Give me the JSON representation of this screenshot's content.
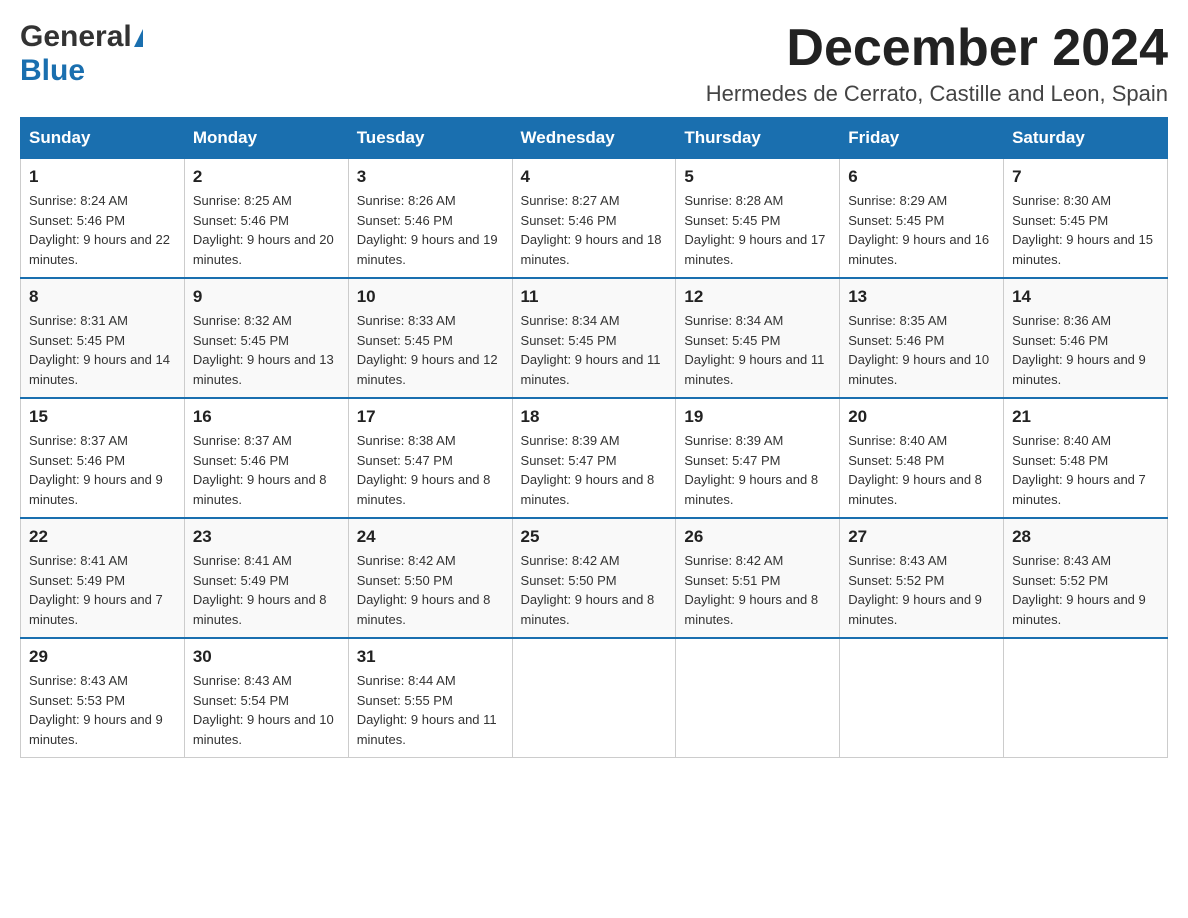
{
  "logo": {
    "general": "General",
    "blue": "Blue",
    "triangle": "▶"
  },
  "title": "December 2024",
  "location": "Hermedes de Cerrato, Castille and Leon, Spain",
  "days_of_week": [
    "Sunday",
    "Monday",
    "Tuesday",
    "Wednesday",
    "Thursday",
    "Friday",
    "Saturday"
  ],
  "weeks": [
    [
      {
        "day": "1",
        "sunrise": "Sunrise: 8:24 AM",
        "sunset": "Sunset: 5:46 PM",
        "daylight": "Daylight: 9 hours and 22 minutes."
      },
      {
        "day": "2",
        "sunrise": "Sunrise: 8:25 AM",
        "sunset": "Sunset: 5:46 PM",
        "daylight": "Daylight: 9 hours and 20 minutes."
      },
      {
        "day": "3",
        "sunrise": "Sunrise: 8:26 AM",
        "sunset": "Sunset: 5:46 PM",
        "daylight": "Daylight: 9 hours and 19 minutes."
      },
      {
        "day": "4",
        "sunrise": "Sunrise: 8:27 AM",
        "sunset": "Sunset: 5:46 PM",
        "daylight": "Daylight: 9 hours and 18 minutes."
      },
      {
        "day": "5",
        "sunrise": "Sunrise: 8:28 AM",
        "sunset": "Sunset: 5:45 PM",
        "daylight": "Daylight: 9 hours and 17 minutes."
      },
      {
        "day": "6",
        "sunrise": "Sunrise: 8:29 AM",
        "sunset": "Sunset: 5:45 PM",
        "daylight": "Daylight: 9 hours and 16 minutes."
      },
      {
        "day": "7",
        "sunrise": "Sunrise: 8:30 AM",
        "sunset": "Sunset: 5:45 PM",
        "daylight": "Daylight: 9 hours and 15 minutes."
      }
    ],
    [
      {
        "day": "8",
        "sunrise": "Sunrise: 8:31 AM",
        "sunset": "Sunset: 5:45 PM",
        "daylight": "Daylight: 9 hours and 14 minutes."
      },
      {
        "day": "9",
        "sunrise": "Sunrise: 8:32 AM",
        "sunset": "Sunset: 5:45 PM",
        "daylight": "Daylight: 9 hours and 13 minutes."
      },
      {
        "day": "10",
        "sunrise": "Sunrise: 8:33 AM",
        "sunset": "Sunset: 5:45 PM",
        "daylight": "Daylight: 9 hours and 12 minutes."
      },
      {
        "day": "11",
        "sunrise": "Sunrise: 8:34 AM",
        "sunset": "Sunset: 5:45 PM",
        "daylight": "Daylight: 9 hours and 11 minutes."
      },
      {
        "day": "12",
        "sunrise": "Sunrise: 8:34 AM",
        "sunset": "Sunset: 5:45 PM",
        "daylight": "Daylight: 9 hours and 11 minutes."
      },
      {
        "day": "13",
        "sunrise": "Sunrise: 8:35 AM",
        "sunset": "Sunset: 5:46 PM",
        "daylight": "Daylight: 9 hours and 10 minutes."
      },
      {
        "day": "14",
        "sunrise": "Sunrise: 8:36 AM",
        "sunset": "Sunset: 5:46 PM",
        "daylight": "Daylight: 9 hours and 9 minutes."
      }
    ],
    [
      {
        "day": "15",
        "sunrise": "Sunrise: 8:37 AM",
        "sunset": "Sunset: 5:46 PM",
        "daylight": "Daylight: 9 hours and 9 minutes."
      },
      {
        "day": "16",
        "sunrise": "Sunrise: 8:37 AM",
        "sunset": "Sunset: 5:46 PM",
        "daylight": "Daylight: 9 hours and 8 minutes."
      },
      {
        "day": "17",
        "sunrise": "Sunrise: 8:38 AM",
        "sunset": "Sunset: 5:47 PM",
        "daylight": "Daylight: 9 hours and 8 minutes."
      },
      {
        "day": "18",
        "sunrise": "Sunrise: 8:39 AM",
        "sunset": "Sunset: 5:47 PM",
        "daylight": "Daylight: 9 hours and 8 minutes."
      },
      {
        "day": "19",
        "sunrise": "Sunrise: 8:39 AM",
        "sunset": "Sunset: 5:47 PM",
        "daylight": "Daylight: 9 hours and 8 minutes."
      },
      {
        "day": "20",
        "sunrise": "Sunrise: 8:40 AM",
        "sunset": "Sunset: 5:48 PM",
        "daylight": "Daylight: 9 hours and 8 minutes."
      },
      {
        "day": "21",
        "sunrise": "Sunrise: 8:40 AM",
        "sunset": "Sunset: 5:48 PM",
        "daylight": "Daylight: 9 hours and 7 minutes."
      }
    ],
    [
      {
        "day": "22",
        "sunrise": "Sunrise: 8:41 AM",
        "sunset": "Sunset: 5:49 PM",
        "daylight": "Daylight: 9 hours and 7 minutes."
      },
      {
        "day": "23",
        "sunrise": "Sunrise: 8:41 AM",
        "sunset": "Sunset: 5:49 PM",
        "daylight": "Daylight: 9 hours and 8 minutes."
      },
      {
        "day": "24",
        "sunrise": "Sunrise: 8:42 AM",
        "sunset": "Sunset: 5:50 PM",
        "daylight": "Daylight: 9 hours and 8 minutes."
      },
      {
        "day": "25",
        "sunrise": "Sunrise: 8:42 AM",
        "sunset": "Sunset: 5:50 PM",
        "daylight": "Daylight: 9 hours and 8 minutes."
      },
      {
        "day": "26",
        "sunrise": "Sunrise: 8:42 AM",
        "sunset": "Sunset: 5:51 PM",
        "daylight": "Daylight: 9 hours and 8 minutes."
      },
      {
        "day": "27",
        "sunrise": "Sunrise: 8:43 AM",
        "sunset": "Sunset: 5:52 PM",
        "daylight": "Daylight: 9 hours and 9 minutes."
      },
      {
        "day": "28",
        "sunrise": "Sunrise: 8:43 AM",
        "sunset": "Sunset: 5:52 PM",
        "daylight": "Daylight: 9 hours and 9 minutes."
      }
    ],
    [
      {
        "day": "29",
        "sunrise": "Sunrise: 8:43 AM",
        "sunset": "Sunset: 5:53 PM",
        "daylight": "Daylight: 9 hours and 9 minutes."
      },
      {
        "day": "30",
        "sunrise": "Sunrise: 8:43 AM",
        "sunset": "Sunset: 5:54 PM",
        "daylight": "Daylight: 9 hours and 10 minutes."
      },
      {
        "day": "31",
        "sunrise": "Sunrise: 8:44 AM",
        "sunset": "Sunset: 5:55 PM",
        "daylight": "Daylight: 9 hours and 11 minutes."
      },
      null,
      null,
      null,
      null
    ]
  ]
}
